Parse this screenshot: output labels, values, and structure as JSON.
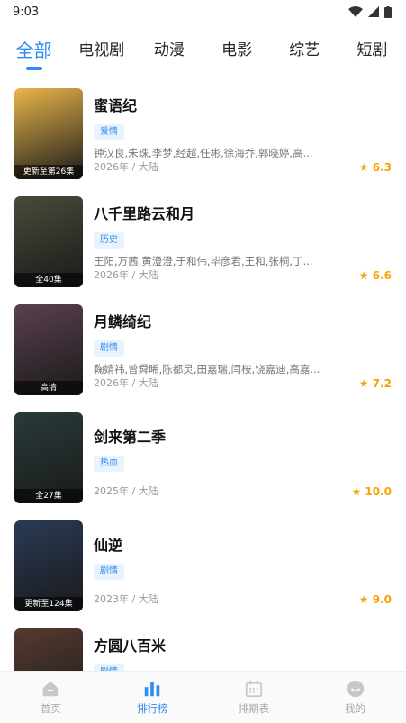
{
  "status": {
    "time": "9:03"
  },
  "tabs": [
    "全部",
    "电视剧",
    "动漫",
    "电影",
    "综艺",
    "短剧"
  ],
  "items": [
    {
      "title": "蜜语纪",
      "tag": "爱情",
      "cast": "钟汉良,朱珠,李梦,经超,任彬,徐海乔,郭晓婷,高...",
      "meta": "2026年 / 大陆",
      "score": "6.3",
      "poster_caption": "更新至第26集",
      "poster_bg": "#e9b54a"
    },
    {
      "title": "八千里路云和月",
      "tag": "历史",
      "cast": "王阳,万茜,黄澄澄,于和伟,毕彦君,王和,张桐,丁...",
      "meta": "2026年 / 大陆",
      "score": "6.6",
      "poster_caption": "全40集",
      "poster_bg": "#4a4a3a"
    },
    {
      "title": "月鳞绮纪",
      "tag": "剧情",
      "cast": "鞠婧祎,曾舜晞,陈都灵,田嘉瑞,闫桉,饶嘉迪,高嘉...",
      "meta": "2026年 / 大陆",
      "score": "7.2",
      "poster_caption": "高清",
      "poster_bg": "#5a4050"
    },
    {
      "title": "剑来第二季",
      "tag": "热血",
      "cast": "",
      "meta": "2025年 / 大陆",
      "score": "10.0",
      "poster_caption": "全27集",
      "poster_bg": "#2a3a3a"
    },
    {
      "title": "仙逆",
      "tag": "剧情",
      "cast": "",
      "meta": "2023年 / 大陆",
      "score": "9.0",
      "poster_caption": "更新至124集",
      "poster_bg": "#2a3a55"
    },
    {
      "title": "方圆八百米",
      "tag": "剧情",
      "cast": "",
      "meta": "",
      "score": "",
      "poster_caption": "",
      "poster_bg": "#553a30"
    }
  ],
  "nav": [
    {
      "label": "首页",
      "icon": "home-icon"
    },
    {
      "label": "排行榜",
      "icon": "chart-icon"
    },
    {
      "label": "排期表",
      "icon": "calendar-icon"
    },
    {
      "label": "我的",
      "icon": "smile-icon"
    }
  ],
  "colors": {
    "accent": "#2f8cf0",
    "star": "#f5a30a"
  }
}
